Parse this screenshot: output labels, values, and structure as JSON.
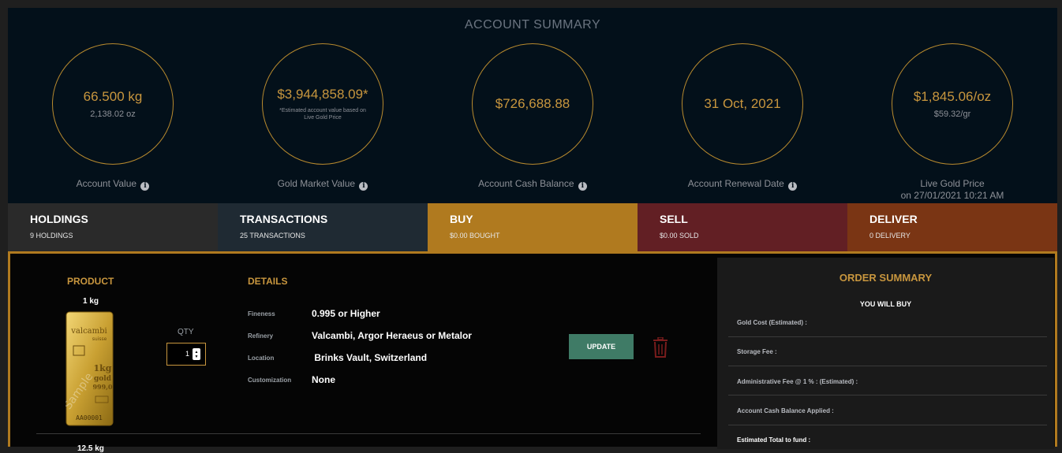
{
  "summary": {
    "title": "ACCOUNT SUMMARY",
    "stats": [
      {
        "main": "66.500 kg",
        "sub": "2,138.02 oz",
        "label": "Account Value"
      },
      {
        "main": "$3,944,858.09*",
        "note": "*Estimated account value based on Live Gold Price",
        "label": "Gold Market Value"
      },
      {
        "main": "$726,688.88",
        "label": "Account Cash Balance"
      },
      {
        "main": "31 Oct, 2021",
        "label": "Account Renewal Date"
      },
      {
        "main": "$1,845.06/oz",
        "sub": "$59.32/gr",
        "label": "Live Gold Price",
        "label2": "on 27/01/2021 10:21 AM"
      }
    ]
  },
  "tabs": [
    {
      "title": "HOLDINGS",
      "sub": "9 HOLDINGS",
      "color": "#2a2a2a"
    },
    {
      "title": "TRANSACTIONS",
      "sub": "25 TRANSACTIONS",
      "color": "#1f2a33"
    },
    {
      "title": "BUY",
      "sub": "$0.00 BOUGHT",
      "color": "#b07a1f"
    },
    {
      "title": "SELL",
      "sub": "$0.00 SOLD",
      "color": "#621f24"
    },
    {
      "title": "DELIVER",
      "sub": "0 DELIVERY",
      "color": "#7a3514"
    }
  ],
  "product": {
    "header": "PRODUCT",
    "weight": "1 kg",
    "next_weight": "12.5 kg",
    "bar_text": {
      "brand": "valcambi",
      "country": "suisse",
      "weight": "1kg",
      "metal": "gold",
      "purity": "999,0",
      "watermark": "Sample",
      "serial": "AA00001"
    }
  },
  "qty": {
    "label": "QTY",
    "value": "1"
  },
  "details": {
    "header": "DETAILS",
    "rows": [
      {
        "label": "Fineness",
        "value": "0.995 or Higher"
      },
      {
        "label": "Refinery",
        "value": "Valcambi, Argor Heraeus or Metalor"
      },
      {
        "label": "Location",
        "value": " Brinks Vault, Switzerland"
      },
      {
        "label": "Customization",
        "value": "None"
      }
    ]
  },
  "actions": {
    "update_label": "UPDATE",
    "delete_icon": "trash-icon"
  },
  "order_summary": {
    "title": "ORDER SUMMARY",
    "subtitle": "YOU WILL BUY",
    "rows": [
      "Gold Cost (Estimated) :",
      "Storage Fee :",
      "Administrative Fee @ 1 % : (Estimated) :",
      "Account Cash Balance Applied :",
      "Estimated Total to fund :"
    ]
  },
  "colors": {
    "accent": "#c8963e",
    "update_button": "#3f7b66",
    "delete_icon": "#7a1c1c"
  }
}
